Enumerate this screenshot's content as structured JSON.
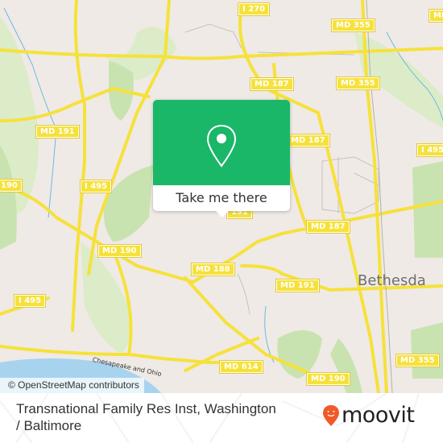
{
  "map": {
    "attribution": "© OpenStreetMap contributors",
    "city_label": "Bethesda",
    "river_label": "Chesapeake and Ohio",
    "colors": {
      "land": "#efeae6",
      "park": "#c9e3b0",
      "light_park": "#dcecc8",
      "road": "#f6e13a",
      "water": "#a7d3ef",
      "river": "#6fb8e0"
    },
    "road_shields": [
      {
        "label": "I 270"
      },
      {
        "label": "MD 355"
      },
      {
        "label": "MD 355"
      },
      {
        "label": "MD 187"
      },
      {
        "label": "MD 187"
      },
      {
        "label": "MD 187"
      },
      {
        "label": "MD 191"
      },
      {
        "label": "I 495"
      },
      {
        "label": "I 495"
      },
      {
        "label": "190"
      },
      {
        "label": "MD 190"
      },
      {
        "label": "I 495"
      },
      {
        "label": "MD 188"
      },
      {
        "label": "MD 191"
      },
      {
        "label": "MD 614"
      },
      {
        "label": "MD 190"
      },
      {
        "label": "MD 355"
      },
      {
        "label": "191"
      },
      {
        "label": "MD"
      }
    ]
  },
  "popup": {
    "icon": "location-pin-icon",
    "button_label": "Take me there",
    "accent_color": "#1ab769"
  },
  "footer": {
    "title": "Transnational Family Res Inst, Washington / Baltimore",
    "logo_text": "moovit",
    "logo_color": "#f05a28"
  }
}
